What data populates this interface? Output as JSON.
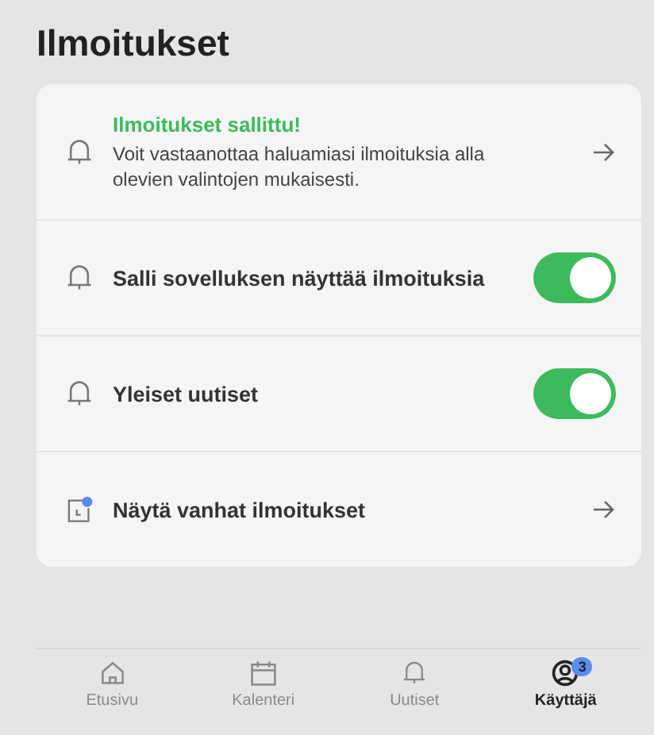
{
  "title": "Ilmoitukset",
  "rows": [
    {
      "kind": "info",
      "title": "Ilmoitukset sallittu!",
      "description": "Voit vastaanottaa haluamiasi ilmoituksia alla olevien valintojen mukaisesti."
    },
    {
      "kind": "toggle",
      "title": "Salli sovelluksen näyttää ilmoituksia",
      "on": true
    },
    {
      "kind": "toggle",
      "title": "Yleiset uutiset",
      "on": true
    },
    {
      "kind": "link",
      "title": "Näytä vanhat ilmoitukset"
    }
  ],
  "nav": [
    {
      "label": "Etusivu",
      "selected": false
    },
    {
      "label": "Kalenteri",
      "selected": false
    },
    {
      "label": "Uutiset",
      "selected": false
    },
    {
      "label": "Käyttäjä",
      "selected": true,
      "badge": "3"
    }
  ]
}
